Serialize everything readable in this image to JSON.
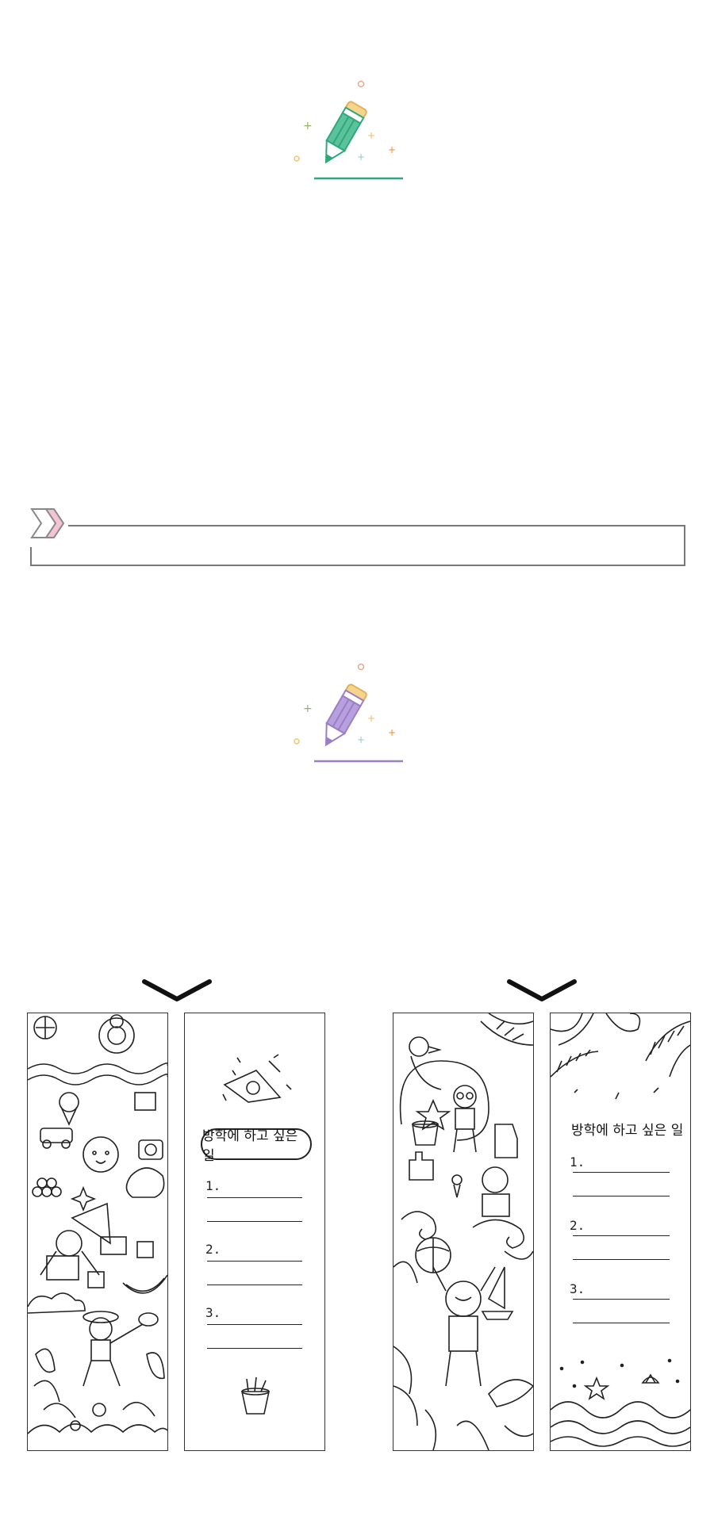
{
  "colors": {
    "green": "#2fa87c",
    "purple": "#9b7fc4",
    "pencil_tip": "#f6d48c",
    "outline": "#333333"
  },
  "icons": {
    "pencil_top": "green-pencil-icon",
    "pencil_middle": "purple-pencil-icon",
    "chevrons": "double-chevron-icon",
    "arrows": "chevron-down-icon"
  },
  "bookmarks": {
    "set1_card2": {
      "heading": "방학에 하고 싶은 일",
      "items": [
        "1.",
        "2.",
        "3."
      ]
    },
    "set2_card2": {
      "heading": "방학에 하고 싶은 일",
      "items": [
        "1.",
        "2.",
        "3."
      ]
    }
  }
}
